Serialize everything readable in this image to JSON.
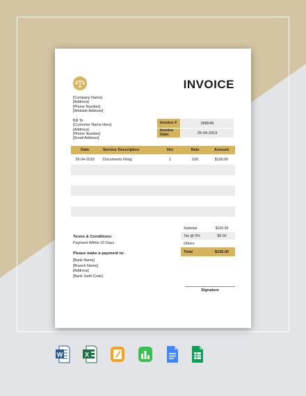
{
  "colors": {
    "accent": "#d6b45e",
    "beige": "#d3c4a2",
    "bg_gray": "#e2e4e7",
    "cell_gray": "#ececec"
  },
  "invoice": {
    "title": "INVOICE",
    "logo": "scales-icon",
    "company": [
      "[Company Name]",
      "[Address]",
      "[Phone Number]",
      "[Website Address]"
    ],
    "bill_to_label": "Bill To:",
    "bill_to": [
      "[Customer Name Here]",
      "[Address]",
      "[Phone Number]",
      "[Email Address]"
    ],
    "meta": [
      {
        "label": "Invoice #",
        "value": "368549"
      },
      {
        "label": "Invoice Date:",
        "value": "25-04-2019"
      }
    ],
    "table": {
      "headers": [
        "Date",
        "Service Description",
        "Hrs",
        "Rate",
        "Amount"
      ],
      "rows": [
        [
          "29-04-2019",
          "Documents Filing",
          "1",
          "100",
          "$100.00"
        ],
        [
          "",
          "",
          "",
          "",
          ""
        ],
        [
          "",
          "",
          "",
          "",
          ""
        ],
        [
          "",
          "",
          "",
          "",
          ""
        ],
        [
          "",
          "",
          "",
          "",
          ""
        ],
        [
          "",
          "",
          "",
          "",
          ""
        ]
      ]
    },
    "summary": [
      {
        "label": "Subtotal",
        "value": "$100.00"
      },
      {
        "label": "Tax @ 5%",
        "value": "$5.00"
      },
      {
        "label": "Others",
        "value": ""
      },
      {
        "label": "Total",
        "value": "$105.00"
      }
    ],
    "terms_title": "Terms & Conditions:",
    "terms_text": "Payment Within 10 Days",
    "payment_title": "Please make a payment to:",
    "payment_lines": [
      "[Bank Name]",
      "[Branch Name]",
      "[Address]",
      "[Bank Swift Code]"
    ],
    "signature_label": "Signature"
  },
  "apps": [
    "word-icon",
    "excel-icon",
    "pages-icon",
    "numbers-icon",
    "google-docs-icon",
    "google-sheets-icon"
  ]
}
